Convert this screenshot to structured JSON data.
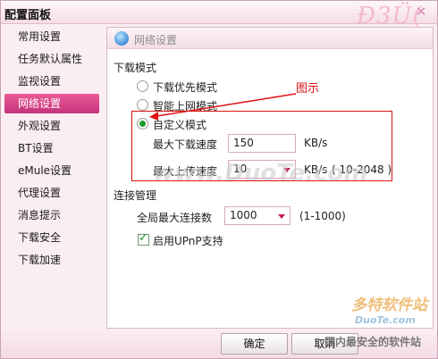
{
  "window": {
    "title": "配置面板",
    "logo_text": "Ð3Ü(",
    "close_glyph": "✕"
  },
  "sidebar": {
    "items": [
      {
        "label": "常用设置"
      },
      {
        "label": "任务默认属性"
      },
      {
        "label": "监视设置"
      },
      {
        "label": "网络设置",
        "active": true
      },
      {
        "label": "外观设置"
      },
      {
        "label": "BT设置"
      },
      {
        "label": "eMule设置"
      },
      {
        "label": "代理设置"
      },
      {
        "label": "消息提示"
      },
      {
        "label": "下载安全"
      },
      {
        "label": "下载加速"
      }
    ]
  },
  "panel": {
    "title": "网络设置",
    "icon": "globe-icon"
  },
  "download_mode": {
    "heading": "下载模式",
    "options": [
      {
        "label": "下载优先模式",
        "selected": false
      },
      {
        "label": "智能上网模式",
        "selected": false
      },
      {
        "label": "自定义模式",
        "selected": true
      }
    ],
    "max_download_label": "最大下载速度",
    "max_download_value": "150",
    "max_download_unit": "KB/s",
    "max_upload_label": "最大上传速度",
    "max_upload_value": "10",
    "max_upload_unit": "KB/s",
    "max_upload_range": "( 10-2048 )"
  },
  "connection": {
    "heading": "连接管理",
    "max_conn_label": "全局最大连接数",
    "max_conn_value": "1000",
    "max_conn_range": "(1-1000)",
    "upnp_label": "启用UPnP支持",
    "upnp_checked": true
  },
  "annotation": {
    "label": "图示",
    "color": "#dd1111"
  },
  "buttons": {
    "ok": "确定",
    "cancel": "取消"
  },
  "watermarks": {
    "center": "www.DuoTe.com",
    "brand": "多特软件站",
    "brand_url": "DuoTe.com",
    "brand_slogan": "国内最安全的软件站"
  },
  "colors": {
    "accent": "#c7327a",
    "sidebar_bg": "#fbeef2"
  }
}
